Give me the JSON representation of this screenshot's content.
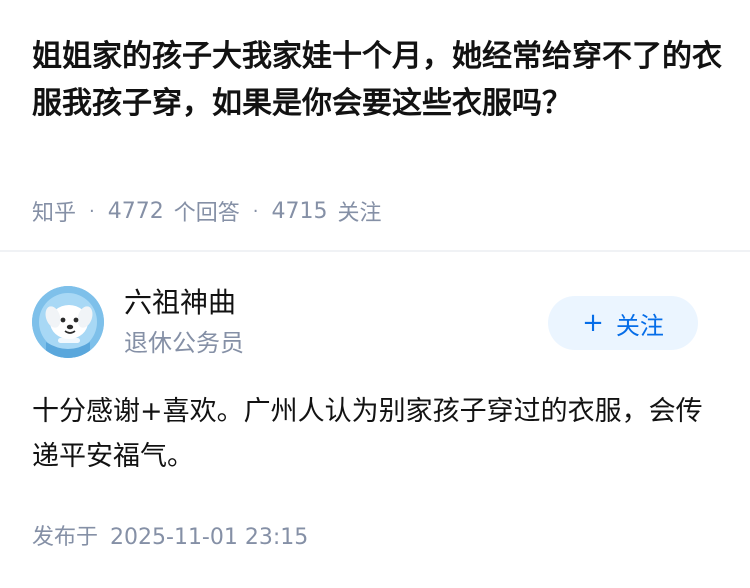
{
  "question": {
    "title": "姐姐家的孩子大我家娃十个月，她经常给穿不了的衣服我孩子穿，如果是你会要这些衣服吗？",
    "source": "知乎",
    "answer_count": "4772",
    "answer_label": "个回答",
    "follower_count": "4715",
    "follower_label": "关注",
    "separator": "·"
  },
  "answer": {
    "author_name": "六祖神曲",
    "author_bio": "退休公务员",
    "follow_plus": "+",
    "follow_label": "关注",
    "content": "十分感谢+喜欢。广州人认为别家孩子穿过的衣服，会传递平安福气。",
    "publish_prefix": "发布于",
    "publish_time": "2025-11-01 23:15"
  },
  "colors": {
    "text_primary": "#121212",
    "text_secondary": "#8590a6",
    "accent_blue": "#056de8",
    "follow_bg": "#ebf5ff",
    "avatar_bg": "#7ec0ea"
  },
  "icons": {
    "avatar": "cartoon-dog-avatar-icon",
    "follow": "plus-icon"
  }
}
